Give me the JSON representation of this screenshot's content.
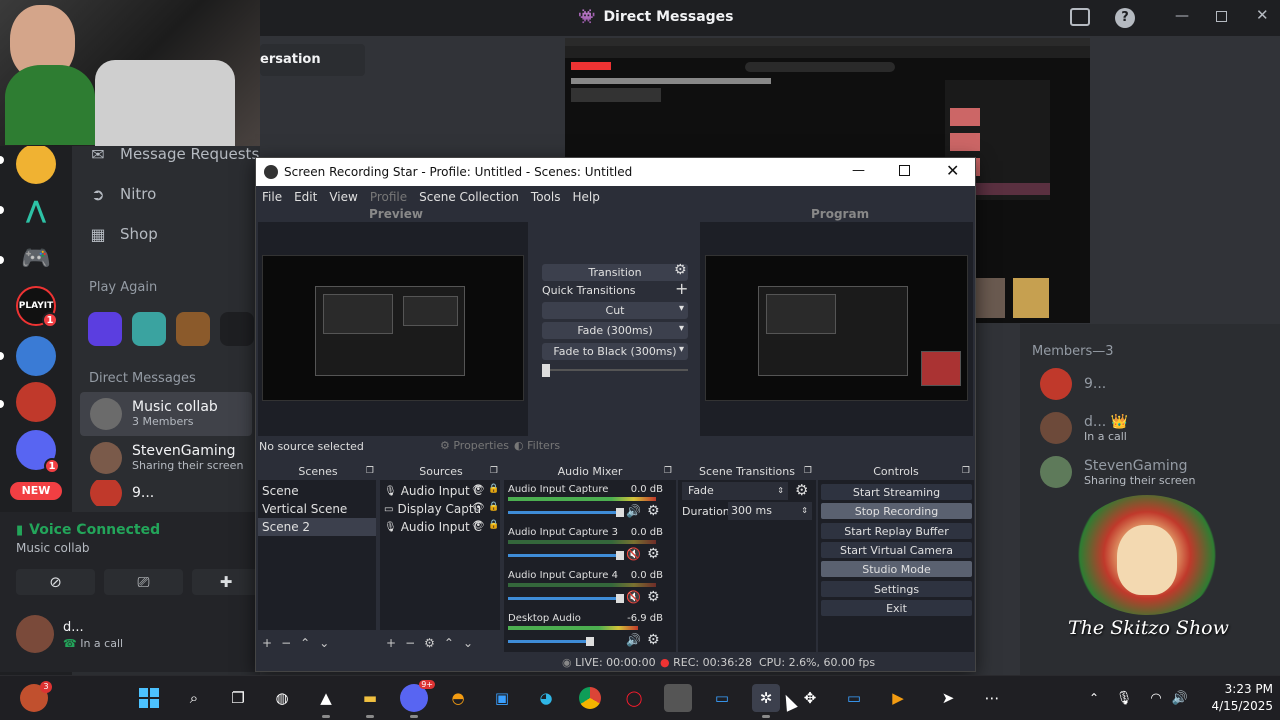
{
  "discord": {
    "top_title": "Direct Messages",
    "conversation_tab": "ersation",
    "nav": {
      "message_requests": "Message Requests",
      "nitro": "Nitro",
      "shop": "Shop"
    },
    "play_again_label": "Play Again",
    "direct_messages_label": "Direct Messages",
    "dms": [
      {
        "name": "Music collab",
        "sub": "3 Members"
      },
      {
        "name": "StevenGaming",
        "sub": "Sharing their screen"
      },
      {
        "name": "9...",
        "sub": ""
      }
    ],
    "new_badge": "NEW",
    "server_badges": [
      "1",
      "1",
      "1"
    ],
    "voice": {
      "status": "Voice Connected",
      "channel": "Music collab"
    },
    "user": {
      "name": "d...",
      "status": "In a call"
    },
    "members": {
      "header": "Members—3",
      "list": [
        {
          "name": "9...",
          "status": ""
        },
        {
          "name": "d... 👑",
          "status": "In a call"
        },
        {
          "name": "StevenGaming",
          "status": "Sharing their screen"
        }
      ]
    },
    "overlay_text": "The Skitzo Show",
    "playit_label": "PLAYIT"
  },
  "obs": {
    "title": "Screen Recording Star - Profile: Untitled - Scenes: Untitled",
    "menu": [
      "File",
      "Edit",
      "View",
      "Profile",
      "Scene Collection",
      "Tools",
      "Help"
    ],
    "preview_label": "Preview",
    "program_label": "Program",
    "transition": {
      "title": "Transition",
      "quick": "Quick Transitions",
      "items": [
        "Cut",
        "Fade (300ms)",
        "Fade to Black (300ms)"
      ]
    },
    "no_source": "No source selected",
    "properties": "Properties",
    "filters": "Filters",
    "docks": {
      "scenes": "Scenes",
      "sources": "Sources",
      "mixer": "Audio Mixer",
      "scene_transitions": "Scene Transitions",
      "controls": "Controls"
    },
    "scenes": [
      "Scene",
      "Vertical Scene",
      "Scene 2"
    ],
    "sources": [
      "Audio Input C",
      "Display Captu",
      "Audio Input C"
    ],
    "mixer": [
      {
        "name": "Audio Input Capture",
        "db": "0.0 dB"
      },
      {
        "name": "Audio Input Capture 3",
        "db": "0.0 dB"
      },
      {
        "name": "Audio Input Capture 4",
        "db": "0.0 dB"
      },
      {
        "name": "Desktop Audio",
        "db": "-6.9 dB"
      }
    ],
    "scene_transition": {
      "type": "Fade",
      "duration_label": "Duration",
      "duration_value": "300 ms"
    },
    "controls": [
      "Start Streaming",
      "Stop Recording",
      "Start Replay Buffer",
      "Start Virtual Camera",
      "Studio Mode",
      "Settings",
      "Exit"
    ],
    "status": {
      "live": "LIVE: 00:00:00",
      "rec": "REC: 00:36:28",
      "cpu": "CPU: 2.6%, 60.00 fps"
    }
  },
  "taskbar": {
    "time": "3:23 PM",
    "date": "4/15/2025",
    "discord_badge": "9+",
    "game_badge": "3"
  }
}
